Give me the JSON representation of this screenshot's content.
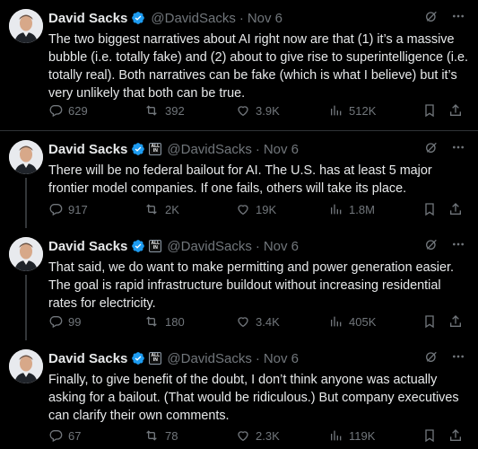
{
  "tweets": [
    {
      "name": "David Sacks",
      "handle": "@DavidSacks",
      "date": "Nov 6",
      "text": "The two biggest narratives about AI right now are that (1) it’s a massive bubble (i.e. totally fake) and (2) about to give rise to superintelligence (i.e. totally real). Both narratives can be fake (which is what I believe) but it’s very unlikely that both can be true.",
      "replies": "629",
      "reposts": "392",
      "likes": "3.9K",
      "views": "512K"
    },
    {
      "name": "David Sacks",
      "handle": "@DavidSacks",
      "date": "Nov 6",
      "text": "There will be no federal bailout for AI. The U.S. has at least 5 major frontier model companies. If one fails, others will take its place.",
      "replies": "917",
      "reposts": "2K",
      "likes": "19K",
      "views": "1.8M"
    },
    {
      "name": "David Sacks",
      "handle": "@DavidSacks",
      "date": "Nov 6",
      "text": "That said, we do want to make permitting and power generation easier. The goal is rapid infrastructure buildout without increasing residential rates for electricity.",
      "replies": "99",
      "reposts": "180",
      "likes": "3.4K",
      "views": "405K"
    },
    {
      "name": "David Sacks",
      "handle": "@DavidSacks",
      "date": "Nov 6",
      "text": "Finally, to give benefit of the doubt, I don’t think anyone was actually asking for a bailout. (That would be ridiculous.) But company executives can clarify their own comments.",
      "replies": "67",
      "reposts": "78",
      "likes": "2.3K",
      "views": "119K"
    }
  ],
  "separator": "·",
  "badge": {
    "top": "ALL",
    "bottom": "IN"
  },
  "icons": {
    "reply": "reply-icon",
    "repost": "repost-icon",
    "like": "like-icon",
    "views": "views-icon",
    "bookmark": "bookmark-icon",
    "share": "share-icon",
    "grok": "grok-icon",
    "more": "more-icon"
  },
  "colors": {
    "background": "#000000",
    "text": "#e7e9ea",
    "secondary": "#71767b",
    "verified": "#1d9bf0",
    "divider": "#2f3336"
  }
}
